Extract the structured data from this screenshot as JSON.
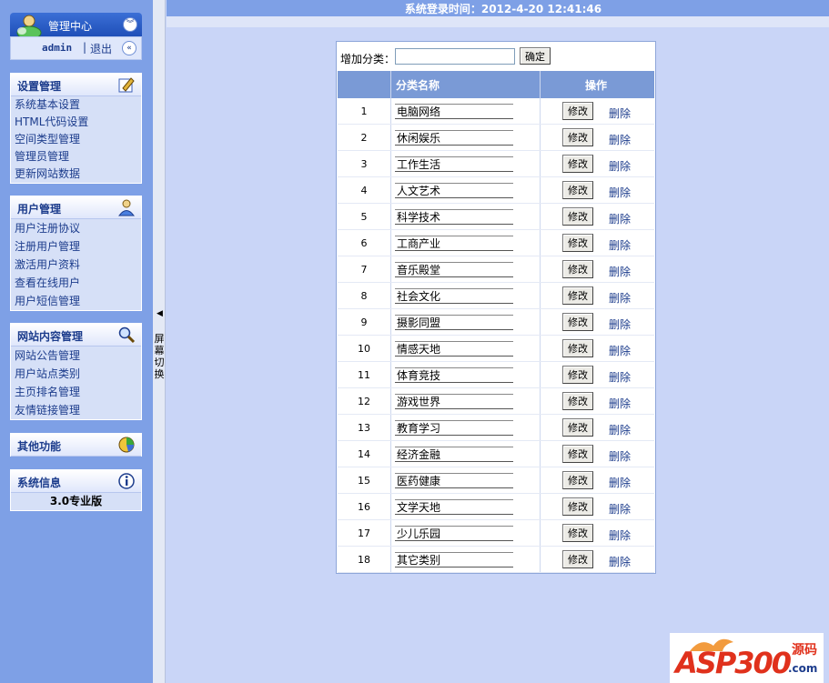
{
  "sidebar": {
    "header": {
      "title": "管理中心",
      "user": "admin",
      "separator": "|",
      "logout": "退出"
    },
    "groups": [
      {
        "title": "设置管理",
        "items": [
          "系统基本设置",
          "HTML代码设置",
          "空间类型管理",
          "管理员管理",
          "更新网站数据"
        ]
      },
      {
        "title": "用户管理",
        "items": [
          "用户注册协议",
          "注册用户管理",
          "激活用户资料",
          "查看在线用户",
          "用户短信管理"
        ]
      },
      {
        "title": "网站内容管理",
        "items": [
          "网站公告管理",
          "用户站点类别",
          "主页排名管理",
          "友情链接管理"
        ]
      },
      {
        "title": "其他功能",
        "items": []
      },
      {
        "title": "系统信息",
        "items": [
          "3.0专业版"
        ]
      }
    ]
  },
  "splitter": {
    "label": "屏幕切换"
  },
  "topbar": {
    "text": "系统登录时间：2012-4-20 12:41:46"
  },
  "category": {
    "add_label": "增加分类：",
    "add_value": "",
    "confirm_label": "确定",
    "headers": {
      "name": "分类名称",
      "action": "操作"
    },
    "edit_label": "修改",
    "delete_label": "删除",
    "rows": [
      {
        "id": "1",
        "name": "电脑网络"
      },
      {
        "id": "2",
        "name": "休闲娱乐"
      },
      {
        "id": "3",
        "name": "工作生活"
      },
      {
        "id": "4",
        "name": "人文艺术"
      },
      {
        "id": "5",
        "name": "科学技术"
      },
      {
        "id": "6",
        "name": "工商产业"
      },
      {
        "id": "7",
        "name": "音乐殿堂"
      },
      {
        "id": "8",
        "name": "社会文化"
      },
      {
        "id": "9",
        "name": "摄影同盟"
      },
      {
        "id": "10",
        "name": "情感天地"
      },
      {
        "id": "11",
        "name": "体育竞技"
      },
      {
        "id": "12",
        "name": "游戏世界"
      },
      {
        "id": "13",
        "name": "教育学习"
      },
      {
        "id": "14",
        "name": "经济金融"
      },
      {
        "id": "15",
        "name": "医药健康"
      },
      {
        "id": "16",
        "name": "文学天地"
      },
      {
        "id": "17",
        "name": "少儿乐园"
      },
      {
        "id": "18",
        "name": "其它类别"
      }
    ]
  },
  "logo": {
    "main": "ASP300",
    "side": "源码",
    "domain": ".com"
  },
  "icons": [
    "collapse-icon",
    "expand-left-icon",
    "pencil-icon",
    "user-icon",
    "magnifier-icon",
    "chart-icon",
    "info-icon"
  ]
}
